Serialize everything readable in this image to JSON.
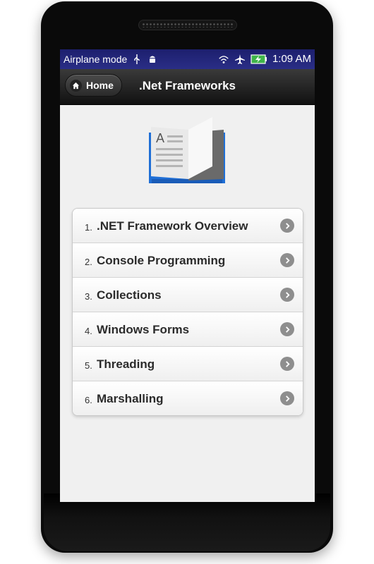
{
  "status_bar": {
    "airplane_label": "Airplane mode",
    "time": "1:09 AM",
    "icons": [
      "usb-icon",
      "android-icon",
      "wifi-icon",
      "airplane-icon",
      "battery-charging-icon"
    ]
  },
  "header": {
    "home_label": "Home",
    "title": ".Net Frameworks",
    "home_icon": "home-icon"
  },
  "hero": {
    "icon": "book-icon"
  },
  "menu": {
    "items": [
      {
        "number": "1.",
        "label": ".NET Framework Overview"
      },
      {
        "number": "2.",
        "label": "Console Programming"
      },
      {
        "number": "3.",
        "label": "Collections"
      },
      {
        "number": "4.",
        "label": "Windows Forms"
      },
      {
        "number": "5.",
        "label": "Threading"
      },
      {
        "number": "6.",
        "label": "Marshalling"
      }
    ],
    "arrow_icon": "chevron-right-icon"
  },
  "colors": {
    "status_bar": "#2a2e86",
    "header": "#1a1a1a",
    "background": "#f0f0f0",
    "book_blue": "#1f6fd6"
  }
}
